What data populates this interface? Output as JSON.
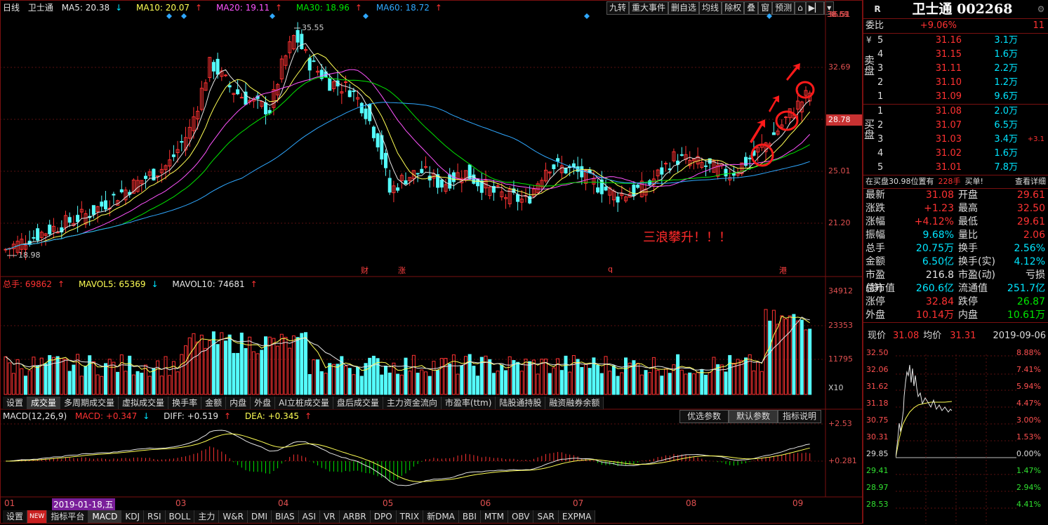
{
  "main": {
    "period": "日线",
    "stock_name": "卫士通",
    "ma": [
      {
        "label": "MA5: 20.38",
        "arrow": "↓"
      },
      {
        "label": "MA10: 20.07",
        "arrow": "↑"
      },
      {
        "label": "MA20: 19.11",
        "arrow": "↑"
      },
      {
        "label": "MA30: 18.96",
        "arrow": "↑"
      },
      {
        "label": "MA60: 18.72",
        "arrow": "↑"
      }
    ],
    "toolbar": [
      "九转",
      "重大事件",
      "删自选",
      "均线",
      "除权",
      "叠",
      "窗",
      "预测"
    ],
    "price_axis": [
      "36.51",
      "32.69",
      "28.78",
      "25.01",
      "21.20"
    ],
    "current_price_tag": "28.78",
    "high_label": "35.55",
    "low_label": "18.98",
    "annotation": "三浪攀升！！！",
    "event_marks": [
      "财",
      "涨",
      "q",
      "港"
    ]
  },
  "volume": {
    "legend": [
      {
        "label": "总手: 69862",
        "arrow": "↑"
      },
      {
        "label": "MAVOL5: 65369",
        "arrow": "↓"
      },
      {
        "label": "MAVOL10: 74681",
        "arrow": "↑"
      }
    ],
    "axis": [
      "34912",
      "23353",
      "11795",
      "X10"
    ]
  },
  "indicator_tabs": [
    "设置",
    "成交量",
    "多周期成交量",
    "虚拟成交量",
    "换手率",
    "金额",
    "内盘",
    "外盘",
    "AI立桩成交量",
    "盘后成交量",
    "主力资金流向",
    "市盈率(ttm)",
    "陆股通持股",
    "融资融券余额"
  ],
  "macd": {
    "legend_name": "MACD(12,26,9)",
    "items": [
      {
        "label": "MACD: +0.347",
        "arrow": "↓"
      },
      {
        "label": "DIFF: +0.519",
        "arrow": "↑"
      },
      {
        "label": "DEA: +0.345",
        "arrow": "↑"
      }
    ],
    "buttons": [
      "优选参数",
      "默认参数",
      "指标说明"
    ],
    "axis": [
      "+2.53",
      "+0.281"
    ]
  },
  "time_axis": [
    "01",
    "2019-01-18,五",
    "03",
    "04",
    "05",
    "06",
    "07",
    "08",
    "09"
  ],
  "bottom_tabs": [
    "设置",
    "NEW",
    "指标平台",
    "MACD",
    "KDJ",
    "RSI",
    "BOLL",
    "主力",
    "W&R",
    "DMI",
    "BIAS",
    "ASI",
    "VR",
    "ARBR",
    "DPO",
    "TRIX",
    "新DMA",
    "BBI",
    "MTM",
    "OBV",
    "SAR",
    "EXPMA"
  ],
  "quote": {
    "badge": "R",
    "title": "卫士通 002268",
    "weibi_label": "委比",
    "weibi": "+9.06%",
    "weicha": "11",
    "sell_label": "卖盘",
    "buy_label": "买盘",
    "yen": "¥",
    "sells": [
      {
        "level": "5",
        "price": "31.16",
        "vol": "3.1万"
      },
      {
        "level": "4",
        "price": "31.15",
        "vol": "1.6万"
      },
      {
        "level": "3",
        "price": "31.11",
        "vol": "2.2万"
      },
      {
        "level": "2",
        "price": "31.10",
        "vol": "1.2万"
      },
      {
        "level": "1",
        "price": "31.09",
        "vol": "9.6万"
      }
    ],
    "buys": [
      {
        "level": "1",
        "price": "31.08",
        "vol": "2.0万",
        "extra": ""
      },
      {
        "level": "2",
        "price": "31.07",
        "vol": "6.5万",
        "extra": ""
      },
      {
        "level": "3",
        "price": "31.03",
        "vol": "3.4万",
        "extra": "+3.1"
      },
      {
        "level": "4",
        "price": "31.02",
        "vol": "1.6万",
        "extra": ""
      },
      {
        "level": "5",
        "price": "31.01",
        "vol": "7.8万",
        "extra": ""
      }
    ],
    "notice_a": "在买盘30.98位置有",
    "notice_b": "228手",
    "notice_c": "买单!",
    "notice_link": "查看详细",
    "stats": [
      {
        "k": "最新",
        "v": "31.08",
        "c": "red",
        "k2": "开盘",
        "v2": "29.61",
        "c2": "red"
      },
      {
        "k": "涨跌",
        "v": "+1.23",
        "c": "red",
        "k2": "最高",
        "v2": "32.50",
        "c2": "red"
      },
      {
        "k": "涨幅",
        "v": "+4.12%",
        "c": "red",
        "k2": "最低",
        "v2": "29.61",
        "c2": "red"
      },
      {
        "k": "振幅",
        "v": "9.68%",
        "c": "cyan",
        "k2": "量比",
        "v2": "2.06",
        "c2": "red"
      },
      {
        "k": "总手",
        "v": "20.75万",
        "c": "cyan",
        "k2": "换手",
        "v2": "2.56%",
        "c2": "cyan"
      },
      {
        "k": "金额",
        "v": "6.50亿",
        "c": "cyan",
        "k2": "换手(实)",
        "v2": "4.12%",
        "c2": "cyan"
      },
      {
        "k": "市盈(静)",
        "v": "216.8",
        "c": "wht",
        "k2": "市盈(动)",
        "v2": "亏损",
        "c2": "wht"
      },
      {
        "k": "总市值",
        "v": "260.6亿",
        "c": "cyan",
        "k2": "流通值",
        "v2": "251.7亿",
        "c2": "cyan"
      },
      {
        "k": "涨停",
        "v": "32.84",
        "c": "red",
        "k2": "跌停",
        "v2": "26.87",
        "c2": "grn"
      },
      {
        "k": "外盘",
        "v": "10.14万",
        "c": "red",
        "k2": "内盘",
        "v2": "10.61万",
        "c2": "grn"
      }
    ],
    "now_label": "现价",
    "now_val": "31.08",
    "avg_label": "均价",
    "avg_val": "31.31",
    "date": "2019-09-06",
    "mini_axis_left": [
      "32.50",
      "32.06",
      "31.62",
      "31.18",
      "30.75",
      "30.31",
      "29.85",
      "29.41",
      "28.97",
      "28.53"
    ],
    "mini_axis_right": [
      "8.88%",
      "7.41%",
      "5.94%",
      "4.47%",
      "3.00%",
      "1.53%",
      "0.00%",
      "1.47%",
      "2.94%",
      "4.41%"
    ]
  }
}
